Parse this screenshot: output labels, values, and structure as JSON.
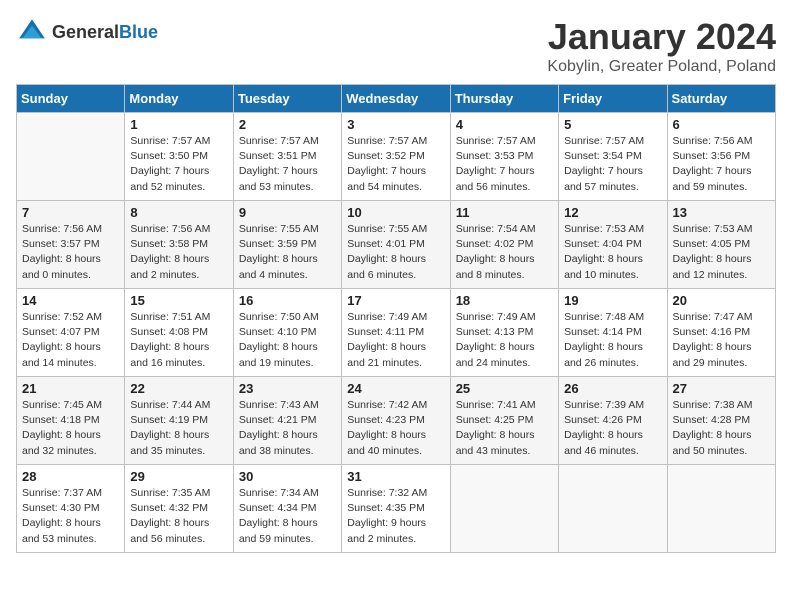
{
  "header": {
    "logo_general": "General",
    "logo_blue": "Blue",
    "title": "January 2024",
    "location": "Kobylin, Greater Poland, Poland"
  },
  "weekdays": [
    "Sunday",
    "Monday",
    "Tuesday",
    "Wednesday",
    "Thursday",
    "Friday",
    "Saturday"
  ],
  "weeks": [
    [
      {
        "day": "",
        "empty": true
      },
      {
        "day": "1",
        "sunrise": "Sunrise: 7:57 AM",
        "sunset": "Sunset: 3:50 PM",
        "daylight": "Daylight: 7 hours and 52 minutes."
      },
      {
        "day": "2",
        "sunrise": "Sunrise: 7:57 AM",
        "sunset": "Sunset: 3:51 PM",
        "daylight": "Daylight: 7 hours and 53 minutes."
      },
      {
        "day": "3",
        "sunrise": "Sunrise: 7:57 AM",
        "sunset": "Sunset: 3:52 PM",
        "daylight": "Daylight: 7 hours and 54 minutes."
      },
      {
        "day": "4",
        "sunrise": "Sunrise: 7:57 AM",
        "sunset": "Sunset: 3:53 PM",
        "daylight": "Daylight: 7 hours and 56 minutes."
      },
      {
        "day": "5",
        "sunrise": "Sunrise: 7:57 AM",
        "sunset": "Sunset: 3:54 PM",
        "daylight": "Daylight: 7 hours and 57 minutes."
      },
      {
        "day": "6",
        "sunrise": "Sunrise: 7:56 AM",
        "sunset": "Sunset: 3:56 PM",
        "daylight": "Daylight: 7 hours and 59 minutes."
      }
    ],
    [
      {
        "day": "7",
        "sunrise": "Sunrise: 7:56 AM",
        "sunset": "Sunset: 3:57 PM",
        "daylight": "Daylight: 8 hours and 0 minutes."
      },
      {
        "day": "8",
        "sunrise": "Sunrise: 7:56 AM",
        "sunset": "Sunset: 3:58 PM",
        "daylight": "Daylight: 8 hours and 2 minutes."
      },
      {
        "day": "9",
        "sunrise": "Sunrise: 7:55 AM",
        "sunset": "Sunset: 3:59 PM",
        "daylight": "Daylight: 8 hours and 4 minutes."
      },
      {
        "day": "10",
        "sunrise": "Sunrise: 7:55 AM",
        "sunset": "Sunset: 4:01 PM",
        "daylight": "Daylight: 8 hours and 6 minutes."
      },
      {
        "day": "11",
        "sunrise": "Sunrise: 7:54 AM",
        "sunset": "Sunset: 4:02 PM",
        "daylight": "Daylight: 8 hours and 8 minutes."
      },
      {
        "day": "12",
        "sunrise": "Sunrise: 7:53 AM",
        "sunset": "Sunset: 4:04 PM",
        "daylight": "Daylight: 8 hours and 10 minutes."
      },
      {
        "day": "13",
        "sunrise": "Sunrise: 7:53 AM",
        "sunset": "Sunset: 4:05 PM",
        "daylight": "Daylight: 8 hours and 12 minutes."
      }
    ],
    [
      {
        "day": "14",
        "sunrise": "Sunrise: 7:52 AM",
        "sunset": "Sunset: 4:07 PM",
        "daylight": "Daylight: 8 hours and 14 minutes."
      },
      {
        "day": "15",
        "sunrise": "Sunrise: 7:51 AM",
        "sunset": "Sunset: 4:08 PM",
        "daylight": "Daylight: 8 hours and 16 minutes."
      },
      {
        "day": "16",
        "sunrise": "Sunrise: 7:50 AM",
        "sunset": "Sunset: 4:10 PM",
        "daylight": "Daylight: 8 hours and 19 minutes."
      },
      {
        "day": "17",
        "sunrise": "Sunrise: 7:49 AM",
        "sunset": "Sunset: 4:11 PM",
        "daylight": "Daylight: 8 hours and 21 minutes."
      },
      {
        "day": "18",
        "sunrise": "Sunrise: 7:49 AM",
        "sunset": "Sunset: 4:13 PM",
        "daylight": "Daylight: 8 hours and 24 minutes."
      },
      {
        "day": "19",
        "sunrise": "Sunrise: 7:48 AM",
        "sunset": "Sunset: 4:14 PM",
        "daylight": "Daylight: 8 hours and 26 minutes."
      },
      {
        "day": "20",
        "sunrise": "Sunrise: 7:47 AM",
        "sunset": "Sunset: 4:16 PM",
        "daylight": "Daylight: 8 hours and 29 minutes."
      }
    ],
    [
      {
        "day": "21",
        "sunrise": "Sunrise: 7:45 AM",
        "sunset": "Sunset: 4:18 PM",
        "daylight": "Daylight: 8 hours and 32 minutes."
      },
      {
        "day": "22",
        "sunrise": "Sunrise: 7:44 AM",
        "sunset": "Sunset: 4:19 PM",
        "daylight": "Daylight: 8 hours and 35 minutes."
      },
      {
        "day": "23",
        "sunrise": "Sunrise: 7:43 AM",
        "sunset": "Sunset: 4:21 PM",
        "daylight": "Daylight: 8 hours and 38 minutes."
      },
      {
        "day": "24",
        "sunrise": "Sunrise: 7:42 AM",
        "sunset": "Sunset: 4:23 PM",
        "daylight": "Daylight: 8 hours and 40 minutes."
      },
      {
        "day": "25",
        "sunrise": "Sunrise: 7:41 AM",
        "sunset": "Sunset: 4:25 PM",
        "daylight": "Daylight: 8 hours and 43 minutes."
      },
      {
        "day": "26",
        "sunrise": "Sunrise: 7:39 AM",
        "sunset": "Sunset: 4:26 PM",
        "daylight": "Daylight: 8 hours and 46 minutes."
      },
      {
        "day": "27",
        "sunrise": "Sunrise: 7:38 AM",
        "sunset": "Sunset: 4:28 PM",
        "daylight": "Daylight: 8 hours and 50 minutes."
      }
    ],
    [
      {
        "day": "28",
        "sunrise": "Sunrise: 7:37 AM",
        "sunset": "Sunset: 4:30 PM",
        "daylight": "Daylight: 8 hours and 53 minutes."
      },
      {
        "day": "29",
        "sunrise": "Sunrise: 7:35 AM",
        "sunset": "Sunset: 4:32 PM",
        "daylight": "Daylight: 8 hours and 56 minutes."
      },
      {
        "day": "30",
        "sunrise": "Sunrise: 7:34 AM",
        "sunset": "Sunset: 4:34 PM",
        "daylight": "Daylight: 8 hours and 59 minutes."
      },
      {
        "day": "31",
        "sunrise": "Sunrise: 7:32 AM",
        "sunset": "Sunset: 4:35 PM",
        "daylight": "Daylight: 9 hours and 2 minutes."
      },
      {
        "day": "",
        "empty": true
      },
      {
        "day": "",
        "empty": true
      },
      {
        "day": "",
        "empty": true
      }
    ]
  ]
}
